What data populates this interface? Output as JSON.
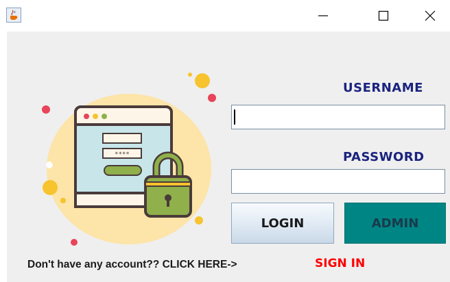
{
  "window": {
    "app_icon": "java-coffee-cup-icon",
    "controls": {
      "minimize": "minimize-icon",
      "maximize": "maximize-icon",
      "close": "close-icon"
    }
  },
  "illustration": {
    "icon": "login-window-padlock-icon",
    "password_mask": "****",
    "colors": {
      "blob": "#fde4a8",
      "accent_yellow": "#f7c32e",
      "accent_red": "#e8445a",
      "lock": "#8fb04a",
      "window": "#c8e6ea",
      "outline": "#4a3a3a"
    }
  },
  "form": {
    "username_label": "USERNAME",
    "username_value": "",
    "password_label": "PASSWORD",
    "password_value": ""
  },
  "buttons": {
    "login": "LOGIN",
    "admin": "ADMIN"
  },
  "footer": {
    "prompt": "Don't have any account?? CLICK HERE->",
    "sign_in": "SIGN IN"
  },
  "colors": {
    "label": "#1a237e",
    "admin_bg": "#008585",
    "sign_in": "#ff0000",
    "panel_bg": "#efefef"
  }
}
